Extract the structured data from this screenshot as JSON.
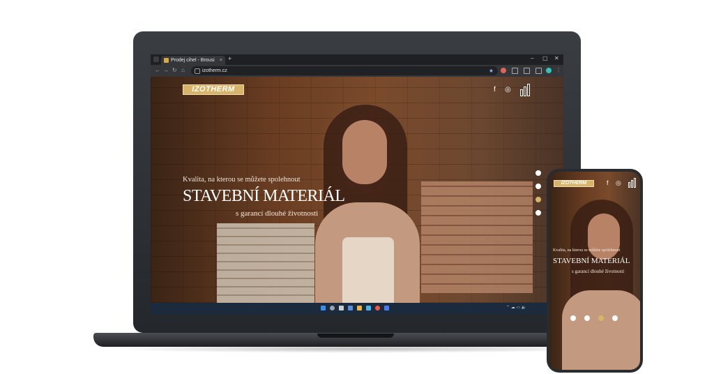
{
  "browser": {
    "tab_title": "Prodej cihel - Brousi",
    "tab_close": "×",
    "new_tab": "+",
    "url": "izotherm.cz",
    "window_controls": {
      "minimize": "–",
      "maximize": "▢",
      "close": "✕"
    },
    "nav": {
      "back": "←",
      "forward": "→",
      "reload": "↻",
      "home": "⌂"
    },
    "star": "★"
  },
  "site": {
    "logo": "IZOTHERM",
    "social": {
      "facebook": "f",
      "instagram": "◎"
    },
    "hero": {
      "subtitle": "Kvalita, na kterou se můžete spolehnout",
      "title": "STAVEBNÍ MATERIÁL",
      "tagline": "s garancí dlouhé životnosti"
    },
    "slides": {
      "count": 4,
      "active_index": 2
    }
  },
  "mobile": {
    "logo": "IZOTHERM",
    "hero": {
      "subtitle": "Kvalita, na kterou se můžete spolehnout",
      "title": "STAVEBNÍ MATERIÁL",
      "tagline": "s garancí dlouhé životnosti"
    },
    "slides": {
      "count": 4,
      "active_index": 2
    }
  },
  "taskbar": {
    "tray": "⌃ ☁ ▭ 🔈"
  },
  "colors": {
    "accent_gold": "#d8b36a",
    "taskbar": "#1b2a3d",
    "browser_dark": "#35363a"
  }
}
